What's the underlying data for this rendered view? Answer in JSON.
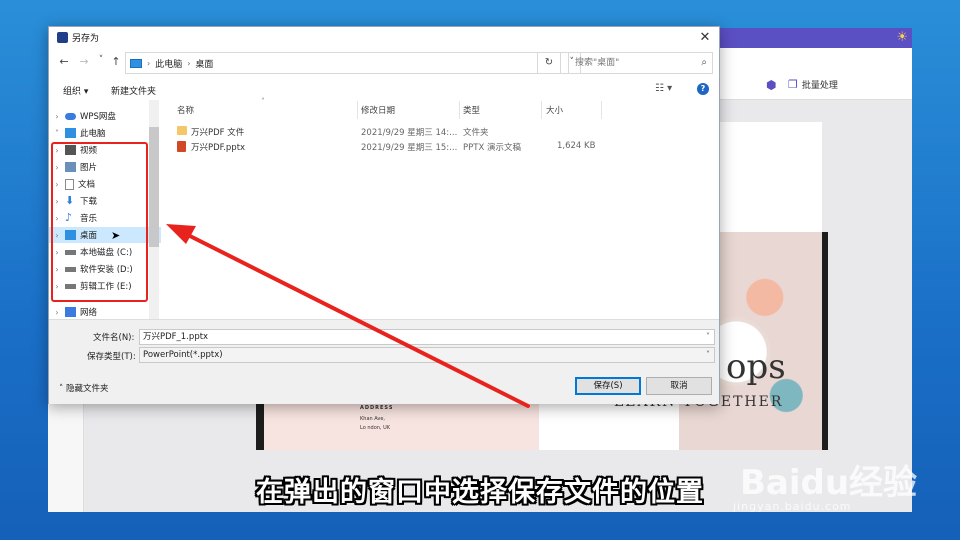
{
  "background_app": {
    "toolbar_batch_label": "批量处理",
    "slide": {
      "big_text": "ops",
      "tagline": "LEARN TOGETHER",
      "address_title": "ADDRESS",
      "address_line1": "Khan Ave,",
      "address_line2": "Lo ndon, UK"
    }
  },
  "dialog": {
    "title": "另存为",
    "close_glyph": "✕",
    "nav": {
      "back": "←",
      "forward": "→",
      "recent": "˅",
      "up": "↑"
    },
    "breadcrumb": [
      "此电脑",
      "桌面"
    ],
    "search_placeholder": "搜索\"桌面\"",
    "commands": {
      "organize": "组织 ▾",
      "new_folder": "新建文件夹"
    },
    "nav_pane": [
      {
        "label": "WPS网盘",
        "icon": "cloud-icon"
      },
      {
        "label": "此电脑",
        "icon": "computer-icon"
      },
      {
        "label": "视频",
        "icon": "video-icon"
      },
      {
        "label": "图片",
        "icon": "pictures-icon"
      },
      {
        "label": "文档",
        "icon": "documents-icon"
      },
      {
        "label": "下载",
        "icon": "download-icon"
      },
      {
        "label": "音乐",
        "icon": "music-icon"
      },
      {
        "label": "桌面",
        "icon": "desktop-icon"
      },
      {
        "label": "本地磁盘 (C:)",
        "icon": "drive-icon"
      },
      {
        "label": "软件安装 (D:)",
        "icon": "drive-icon"
      },
      {
        "label": "剪辑工作 (E:)",
        "icon": "drive-icon"
      },
      {
        "label": "网络",
        "icon": "network-icon"
      }
    ],
    "columns": {
      "name": "名称",
      "modified": "修改日期",
      "type": "类型",
      "size": "大小"
    },
    "files": [
      {
        "name": "万兴PDF 文件",
        "modified": "2021/9/29 星期三 14:...",
        "type": "文件夹",
        "size": "",
        "icon": "folder-icon"
      },
      {
        "name": "万兴PDF.pptx",
        "modified": "2021/9/29 星期三 15:...",
        "type": "PPTX 演示文稿",
        "size": "1,624 KB",
        "icon": "pptx-file-icon"
      }
    ],
    "filename_label": "文件名(N):",
    "filename_value": "万兴PDF_1.pptx",
    "filetype_label": "保存类型(T):",
    "filetype_value": "PowerPoint(*.pptx)",
    "hide_folders": "隐藏文件夹",
    "save_button": "保存(S)",
    "cancel_button": "取消"
  },
  "caption": "在弹出的窗口中选择保存文件的位置",
  "watermark": {
    "main": "Baidu经验",
    "sub": "jingyan.baidu.com"
  },
  "colors": {
    "annotation_red": "#e8231e",
    "selection_blue": "#cce8ff",
    "desktop_blue": "#1a6fc7"
  }
}
